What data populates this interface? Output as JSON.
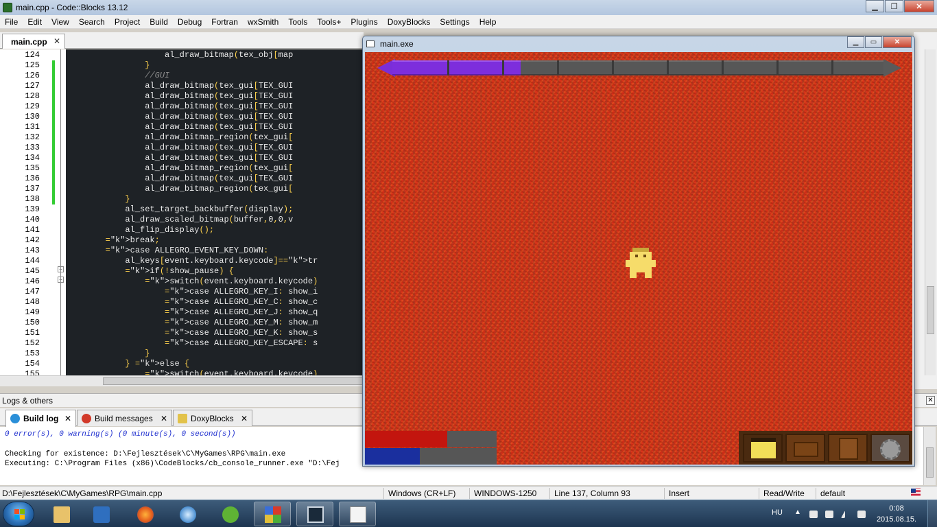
{
  "window": {
    "title": "main.cpp - Code::Blocks 13.12"
  },
  "menu": [
    "File",
    "Edit",
    "View",
    "Search",
    "Project",
    "Build",
    "Debug",
    "Fortran",
    "wxSmith",
    "Tools",
    "Tools+",
    "Plugins",
    "DoxyBlocks",
    "Settings",
    "Help"
  ],
  "editor": {
    "tab_label": "main.cpp",
    "tab_close": "✕",
    "lines": [
      {
        "no": "124",
        "code": "                    al_draw_bitmap(tex_obj[map"
      },
      {
        "no": "125",
        "code": "                }"
      },
      {
        "no": "126",
        "code": "                //GUI"
      },
      {
        "no": "127",
        "code": "                al_draw_bitmap(tex_gui[TEX_GUI"
      },
      {
        "no": "128",
        "code": "                al_draw_bitmap(tex_gui[TEX_GUI"
      },
      {
        "no": "129",
        "code": "                al_draw_bitmap(tex_gui[TEX_GUI"
      },
      {
        "no": "130",
        "code": "                al_draw_bitmap(tex_gui[TEX_GUI"
      },
      {
        "no": "131",
        "code": "                al_draw_bitmap(tex_gui[TEX_GUI"
      },
      {
        "no": "132",
        "code": "                al_draw_bitmap_region(tex_gui["
      },
      {
        "no": "133",
        "code": "                al_draw_bitmap(tex_gui[TEX_GUI"
      },
      {
        "no": "134",
        "code": "                al_draw_bitmap(tex_gui[TEX_GUI"
      },
      {
        "no": "135",
        "code": "                al_draw_bitmap_region(tex_gui["
      },
      {
        "no": "136",
        "code": "                al_draw_bitmap(tex_gui[TEX_GUI"
      },
      {
        "no": "137",
        "code": "                al_draw_bitmap_region(tex_gui["
      },
      {
        "no": "138",
        "code": "            }"
      },
      {
        "no": "139",
        "code": "            al_set_target_backbuffer(display);"
      },
      {
        "no": "140",
        "code": "            al_draw_scaled_bitmap(buffer,0,0,v"
      },
      {
        "no": "141",
        "code": "            al_flip_display();"
      },
      {
        "no": "142",
        "code": "        break;"
      },
      {
        "no": "143",
        "code": "        case ALLEGRO_EVENT_KEY_DOWN:"
      },
      {
        "no": "144",
        "code": "            al_keys[event.keyboard.keycode]=tr"
      },
      {
        "no": "145",
        "code": "            if(!show_pause) {"
      },
      {
        "no": "146",
        "code": "                switch(event.keyboard.keycode)"
      },
      {
        "no": "147",
        "code": "                    case ALLEGRO_KEY_I: show_i"
      },
      {
        "no": "148",
        "code": "                    case ALLEGRO_KEY_C: show_c"
      },
      {
        "no": "149",
        "code": "                    case ALLEGRO_KEY_J: show_q"
      },
      {
        "no": "150",
        "code": "                    case ALLEGRO_KEY_M: show_m"
      },
      {
        "no": "151",
        "code": "                    case ALLEGRO_KEY_K: show_s"
      },
      {
        "no": "152",
        "code": "                    case ALLEGRO_KEY_ESCAPE: s"
      },
      {
        "no": "153",
        "code": "                }"
      },
      {
        "no": "154",
        "code": "            } else {"
      },
      {
        "no": "155",
        "code": "                switch(event.keyboard.keycode)"
      }
    ]
  },
  "logs": {
    "header": "Logs & others",
    "close": "✕",
    "tabs": [
      {
        "label": "Build log",
        "close": "✕"
      },
      {
        "label": "Build messages",
        "close": "✕"
      },
      {
        "label": "DoxyBlocks",
        "close": "✕"
      }
    ],
    "lines": [
      "0 error(s), 0 warning(s) (0 minute(s), 0 second(s))",
      "",
      "Checking for existence: D:\\Fejlesztések\\C\\MyGames\\RPG\\main.exe",
      "Executing: C:\\Program Files (x86)\\CodeBlocks/cb_console_runner.exe \"D:\\Fej"
    ]
  },
  "status": {
    "path": "D:\\Fejlesztések\\C\\MyGames\\RPG\\main.cpp",
    "eol": "Windows (CR+LF)",
    "encoding": "WINDOWS-1250",
    "position": "Line 137, Column 93",
    "mode": "Insert",
    "access": "Read/Write",
    "lang": "default"
  },
  "game": {
    "title": "main.exe",
    "top_bar_fill": 0.26,
    "player_icon": "player-sprite"
  },
  "taskbar": {
    "lang": "HU",
    "time": "0:08",
    "date": "2015.08.15."
  },
  "colors": {
    "game_bg": "#d8351b",
    "purple_bar": "#7d2edc",
    "health": "#c3150e",
    "mana": "#1a2f9e",
    "change_bar": "#33cc33"
  }
}
